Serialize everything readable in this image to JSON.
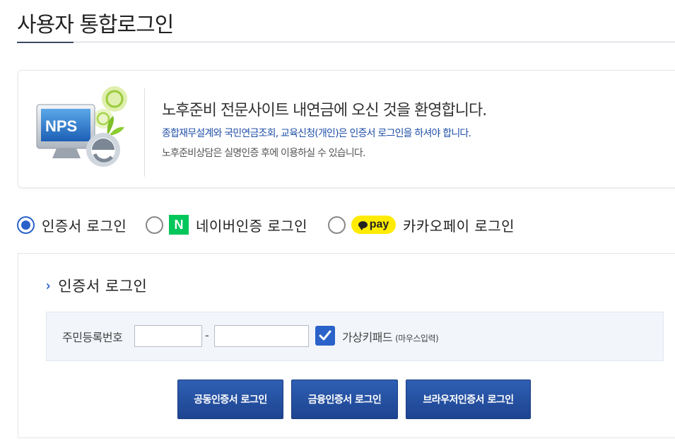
{
  "page": {
    "title": "사용자 통합로그인"
  },
  "welcome": {
    "logo_text": "NPS",
    "heading": "노후준비 전문사이트 내연금에 오신 것을 환영합니다.",
    "notice": "종합재무설계와 국민연금조회, 교육신청(개인)은 인증서 로그인을 하셔야 합니다.",
    "sub": "노후준비상담은 실명인증 후에 이용하실 수 있습니다."
  },
  "login_methods": [
    {
      "label": "인증서 로그인",
      "selected": true
    },
    {
      "label": "네이버인증 로그인",
      "icon": "naver-n-icon",
      "icon_text": "N",
      "selected": false
    },
    {
      "label": "카카오페이 로그인",
      "icon": "kakaopay-icon",
      "icon_text": "pay",
      "selected": false
    }
  ],
  "cert_login": {
    "section_title": "인증서 로그인",
    "ssn_label": "주민등록번호",
    "ssn_separator": "-",
    "ssn_front_value": "",
    "ssn_back_value": "",
    "virtual_keypad_label": "가상키패드",
    "virtual_keypad_sub": "(마우스입력)",
    "virtual_keypad_checked": true,
    "buttons": {
      "public_cert": "공동인증서 로그인",
      "finance_cert": "금융인증서 로그인",
      "browser_cert": "브라우저인증서 로그인"
    }
  },
  "colors": {
    "accent": "#2a62c9",
    "button": "#1d4490",
    "naver": "#03c75a",
    "kakao": "#ffeb00",
    "notice_text": "#1f4fa8"
  }
}
